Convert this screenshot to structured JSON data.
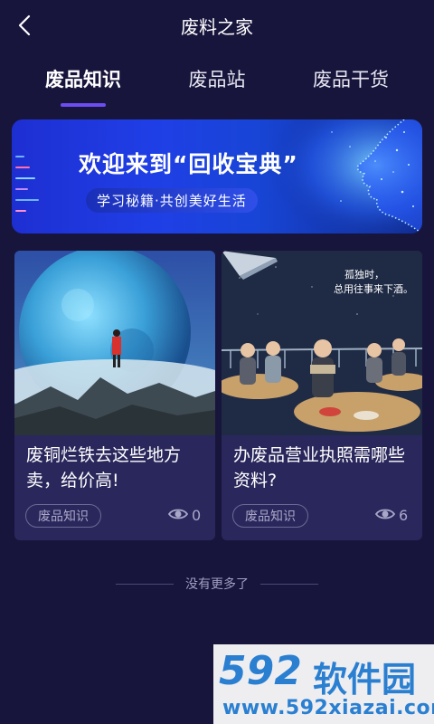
{
  "header": {
    "title": "废料之家"
  },
  "tabs": [
    {
      "label": "废品知识",
      "active": true
    },
    {
      "label": "废品站",
      "active": false
    },
    {
      "label": "废品干货",
      "active": false
    }
  ],
  "banner": {
    "headline": "欢迎来到“回收宝典”",
    "subtitle": "学习秘籍·共创美好生活"
  },
  "cards": [
    {
      "title": "废铜烂铁去这些地方卖，给价高!",
      "tag": "废品知识",
      "views": "0",
      "image": "planet-illustration"
    },
    {
      "title": "办废品营业执照需哪些资料?",
      "tag": "废品知识",
      "views": "6",
      "image": "restaurant-illustration",
      "image_caption": [
        "孤独时，",
        "总用往事来下酒。"
      ]
    }
  ],
  "footer": {
    "no_more": "没有更多了"
  },
  "watermark": {
    "logo": "592",
    "name": "软件园",
    "url": "www.592xiazai.com"
  },
  "colors": {
    "background": "#18153d",
    "card": "#2a275c",
    "accent": "#6d4cf2",
    "banner": "#1f3fe6"
  }
}
